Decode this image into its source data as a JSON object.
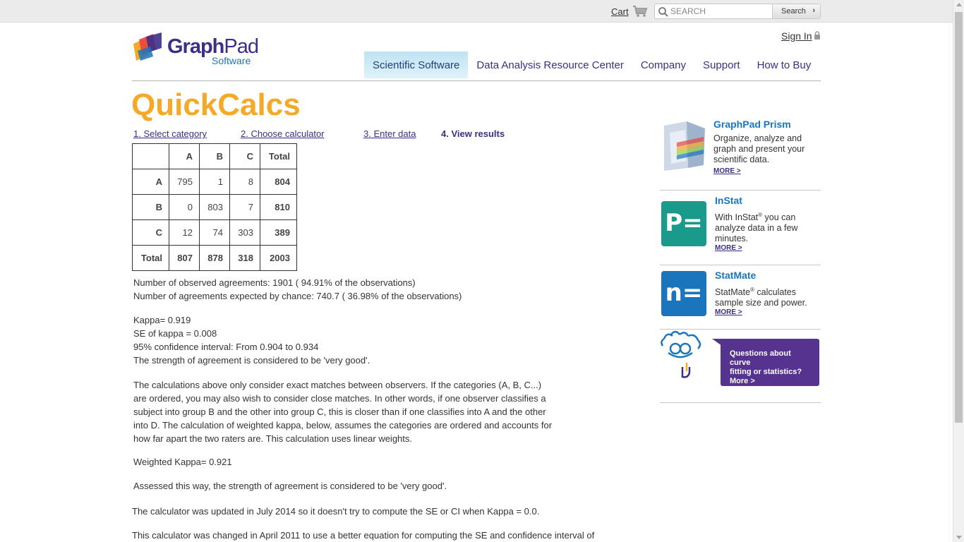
{
  "topbar": {
    "cart_label": "Cart",
    "search_placeholder": "SEARCH",
    "search_button": "Search"
  },
  "header": {
    "logo_graph": "Graph",
    "logo_pad": "Pad",
    "logo_sub": "Software",
    "signin_label": "Sign In",
    "nav": [
      {
        "label": "Scientific Software"
      },
      {
        "label": "Data Analysis Resource Center"
      },
      {
        "label": "Company"
      },
      {
        "label": "Support"
      },
      {
        "label": "How to Buy"
      }
    ]
  },
  "page_title": "QuickCalcs",
  "steps": [
    {
      "label": "1. Select category"
    },
    {
      "label": "2. Choose calculator"
    },
    {
      "label": "3. Enter data"
    },
    {
      "label": "4. View results"
    }
  ],
  "table": {
    "header": [
      "",
      "A",
      "B",
      "C",
      "Total"
    ],
    "rows": [
      [
        "A",
        "795",
        "1",
        "8",
        "804"
      ],
      [
        "B",
        "0",
        "803",
        "7",
        "810"
      ],
      [
        "C",
        "12",
        "74",
        "303",
        "389"
      ],
      [
        "Total",
        "807",
        "878",
        "318",
        "2003"
      ]
    ]
  },
  "results": {
    "observed": "Number of observed agreements: 1901 ( 94.91% of the observations)",
    "expected": "Number of agreements expected by chance: 740.7 ( 36.98% of the observations)",
    "kappa": "Kappa= 0.919",
    "se": "SE of kappa = 0.008",
    "ci": "95% confidence interval: From 0.904 to 0.934",
    "strength": "The strength of agreement is considered to be 'very good'.",
    "explanation": "The calculations above only consider exact matches between observers. If the categories (A, B, C...) are ordered, you may also wish to consider close matches. In other words, if one observer classifies a subject into group B and the other into group C, this is closer than if one classifies into A and the other into D. The calculation of weighted kappa, below, assumes the categories are ordered and accounts for how far apart the two raters are. This calculation uses linear weights.",
    "weighted": "Weighted Kappa= 0.921",
    "weighted_strength": "Assessed this way, the strength of agreement is considered to be 'very good'.",
    "note_2014": "The calculator was updated in July 2014 so it doesn't try to compute the SE or CI when Kappa = 0.0.",
    "note_2011": "This calculator was changed in April 2011 to use a better equation for computing the SE and confidence interval of"
  },
  "sidebar": {
    "prism": {
      "title": "GraphPad Prism",
      "desc": "Organize, analyze and graph and present your scientific data.",
      "more": "MORE >"
    },
    "instat": {
      "title": "InStat",
      "desc_pre": "With InStat",
      "reg": "®",
      "desc_post": " you can analyze data in a few minutes.",
      "more": "MORE >",
      "icon_text": "P="
    },
    "statmate": {
      "title": "StatMate",
      "desc_pre": "StatMate",
      "reg": "®",
      "desc_post": " calculates sample size and power.",
      "more": "MORE >",
      "icon_text": "n="
    },
    "bubble": {
      "line1": "Questions about curve",
      "line2": "fitting or statistics?",
      "line3": "More >"
    }
  },
  "colors": {
    "brand_purple": "#3d2e88",
    "brand_blue": "#1b75bc",
    "title_orange": "#f5a928",
    "instat_teal": "#1a9a8a",
    "statmate_blue": "#1b75bc",
    "bubble_purple": "#55338f"
  }
}
